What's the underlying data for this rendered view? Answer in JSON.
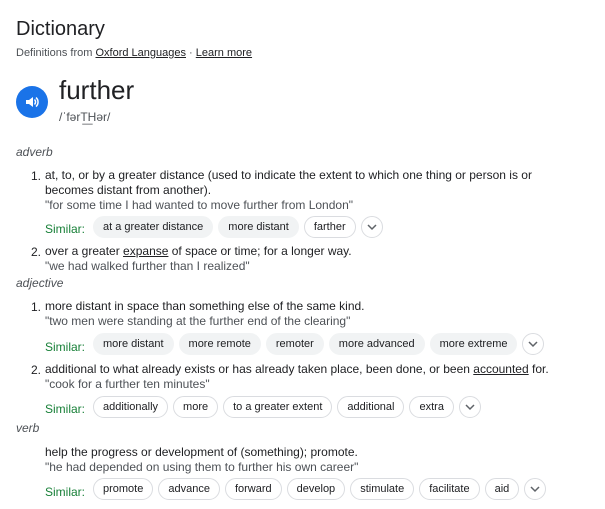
{
  "header": {
    "title": "Dictionary",
    "source_prefix": "Definitions from ",
    "source_link": "Oxford Languages",
    "separator": " · ",
    "learn_more": "Learn more"
  },
  "entry": {
    "word": "further",
    "phonetic": "/ˈfərT͟Hər/"
  },
  "pos": {
    "adverb": "adverb",
    "adjective": "adjective",
    "verb": "verb"
  },
  "similar_label": "Similar:",
  "adverb": {
    "d1": {
      "num": "1.",
      "line1": "at, to, or by a greater distance (used to indicate the extent to which one thing or person is or",
      "line2": "becomes distant from another).",
      "example": "\"for some time I had wanted to move further from London\"",
      "similar": [
        "at a greater distance",
        "more distant",
        "farther"
      ]
    },
    "d2": {
      "num": "2.",
      "pre": "over a greater ",
      "link": "expanse",
      "post": " of space or time; for a longer way.",
      "example": "\"we had walked further than I realized\""
    }
  },
  "adjective": {
    "d1": {
      "num": "1.",
      "text": "more distant in space than something else of the same kind.",
      "example": "\"two men were standing at the further end of the clearing\"",
      "similar": [
        "more distant",
        "more remote",
        "remoter",
        "more advanced",
        "more extreme"
      ]
    },
    "d2": {
      "num": "2.",
      "pre": "additional to what already exists or has already taken place, been done, or been ",
      "link": "accounted",
      "post": " for.",
      "example": "\"cook for a further ten minutes\"",
      "similar": [
        "additionally",
        "more",
        "to a greater extent",
        "additional",
        "extra"
      ]
    }
  },
  "verb": {
    "d1": {
      "text": "help the progress or development of (something); promote.",
      "example": "\"he had depended on using them to further his own career\"",
      "similar": [
        "promote",
        "advance",
        "forward",
        "develop",
        "stimulate",
        "facilitate",
        "aid"
      ]
    }
  }
}
